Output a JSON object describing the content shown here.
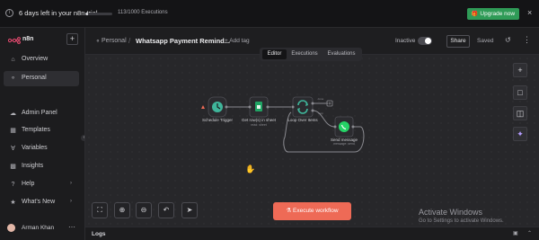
{
  "banner": {
    "trial_text": "6 days left in your n8n trial",
    "executions_text": "113/1000 Executions",
    "executions_progress": 0.113,
    "upgrade_label": "Upgrade now",
    "upgrade_color": "#2f9b57"
  },
  "sidebar": {
    "brand": "n8n",
    "items": [
      {
        "label": "Overview",
        "icon": "home-icon"
      },
      {
        "label": "Personal",
        "icon": "user-icon",
        "active": true
      },
      {
        "label": "Admin Panel",
        "icon": "cloud-icon"
      },
      {
        "label": "Templates",
        "icon": "templates-icon"
      },
      {
        "label": "Variables",
        "icon": "variables-icon"
      },
      {
        "label": "Insights",
        "icon": "insights-icon"
      },
      {
        "label": "Help",
        "icon": "help-icon"
      },
      {
        "label": "What's New",
        "icon": "bell-icon"
      }
    ],
    "user_name": "Arman Khan"
  },
  "header": {
    "breadcrumb": "Personal",
    "workflow_name": "Whatsapp Payment Remind...",
    "add_tag": "+ Add tag",
    "status": "Inactive",
    "share": "Share",
    "saved": "Saved"
  },
  "tabs": [
    "Editor",
    "Executions",
    "Evaluations"
  ],
  "active_tab": "Editor",
  "nodes": [
    {
      "label": "Schedule Trigger",
      "sub": "",
      "color": "#3fb59a",
      "icon": "clock-icon"
    },
    {
      "label": "Get row(s) in sheet",
      "sub": "read: sheet",
      "color": "#20a464",
      "icon": "sheets-icon"
    },
    {
      "label": "Loop Over Items",
      "sub": "",
      "color": "#3fb59a",
      "icon": "loop-icon"
    },
    {
      "label": "Send message",
      "sub": "message: send",
      "color": "#25d366",
      "icon": "whatsapp-icon"
    }
  ],
  "loop_outputs": [
    "done",
    "loop"
  ],
  "execute_label": "Execute workflow",
  "activate": {
    "title": "Activate Windows",
    "subtitle": "Go to Settings to activate Windows."
  },
  "logs_label": "Logs",
  "accent_color": "#ee6a56"
}
